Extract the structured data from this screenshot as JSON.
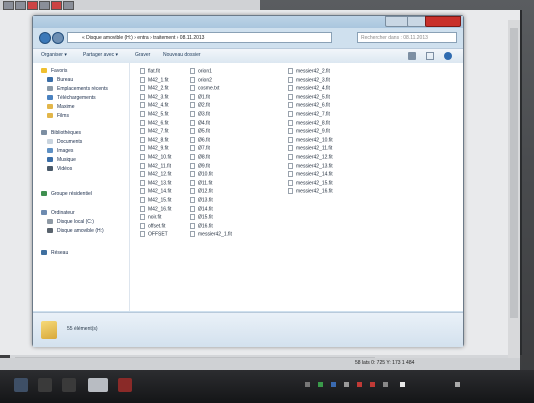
{
  "window": {
    "address_path": "« Disque amovible (H:) › entra › traitement › 08.11.2013",
    "search_placeholder": "Rechercher dans : 08.11.2013"
  },
  "toolbar": {
    "organize": "Organiser ▾",
    "share": "Partager avec ▾",
    "burn": "Graver",
    "new_folder": "Nouveau dossier"
  },
  "nav": {
    "favorites": "Favoris",
    "desktop": "Bureau",
    "recent": "Emplacements récents",
    "downloads": "Téléchargements",
    "home": "Maxime",
    "films": "Films",
    "libraries": "Bibliothèques",
    "documents": "Documents",
    "images": "Images",
    "music": "Musique",
    "videos": "Vidéos",
    "homegroup": "Groupe résidentiel",
    "computer": "Ordinateur",
    "local_disk": "Disque local (C:)",
    "removable": "Disque amovible (H:)",
    "network": "Réseau"
  },
  "files": {
    "col1": [
      "flat.fit",
      "M42_1.fit",
      "M42_2.fit",
      "M42_3.fit",
      "M42_4.fit",
      "M42_5.fit",
      "M42_6.fit",
      "M42_7.fit",
      "M42_8.fit",
      "M42_9.fit",
      "M42_10.fit",
      "M42_11.fit",
      "M42_12.fit",
      "M42_13.fit",
      "M42_14.fit",
      "M42_15.fit",
      "M42_16.fit",
      "noir.fit",
      "offset.fit",
      "OFFSET"
    ],
    "col2": [
      "orion1",
      "orion2",
      "cosme.txt",
      "Ø1.fit",
      "Ø2.fit",
      "Ø3.fit",
      "Ø4.fit",
      "Ø5.fit",
      "Ø6.fit",
      "Ø7.fit",
      "Ø8.fit",
      "Ø9.fit",
      "Ø10.fit",
      "Ø11.fit",
      "Ø12.fit",
      "Ø13.fit",
      "Ø14.fit",
      "Ø15.fit",
      "Ø16.fit",
      "messier42_1.fit"
    ],
    "col3": [
      "messier42_2.fit",
      "messier42_3.fit",
      "messier42_4.fit",
      "messier42_5.fit",
      "messier42_6.fit",
      "messier42_7.fit",
      "messier42_8.fit",
      "messier42_9.fit",
      "messier42_10.fit",
      "messier42_11.fit",
      "messier42_12.fit",
      "messier42_13.fit",
      "messier42_14.fit",
      "messier42_15.fit",
      "messier42_16.fit"
    ]
  },
  "details": {
    "count": "55 élément(s)"
  },
  "statusbar": {
    "coords": "58 lats 0: 725   Y: 173   1 484"
  },
  "colors": {
    "accent": "#3b78b8",
    "close_button": "#c8302b",
    "folder": "#e2b64a"
  }
}
